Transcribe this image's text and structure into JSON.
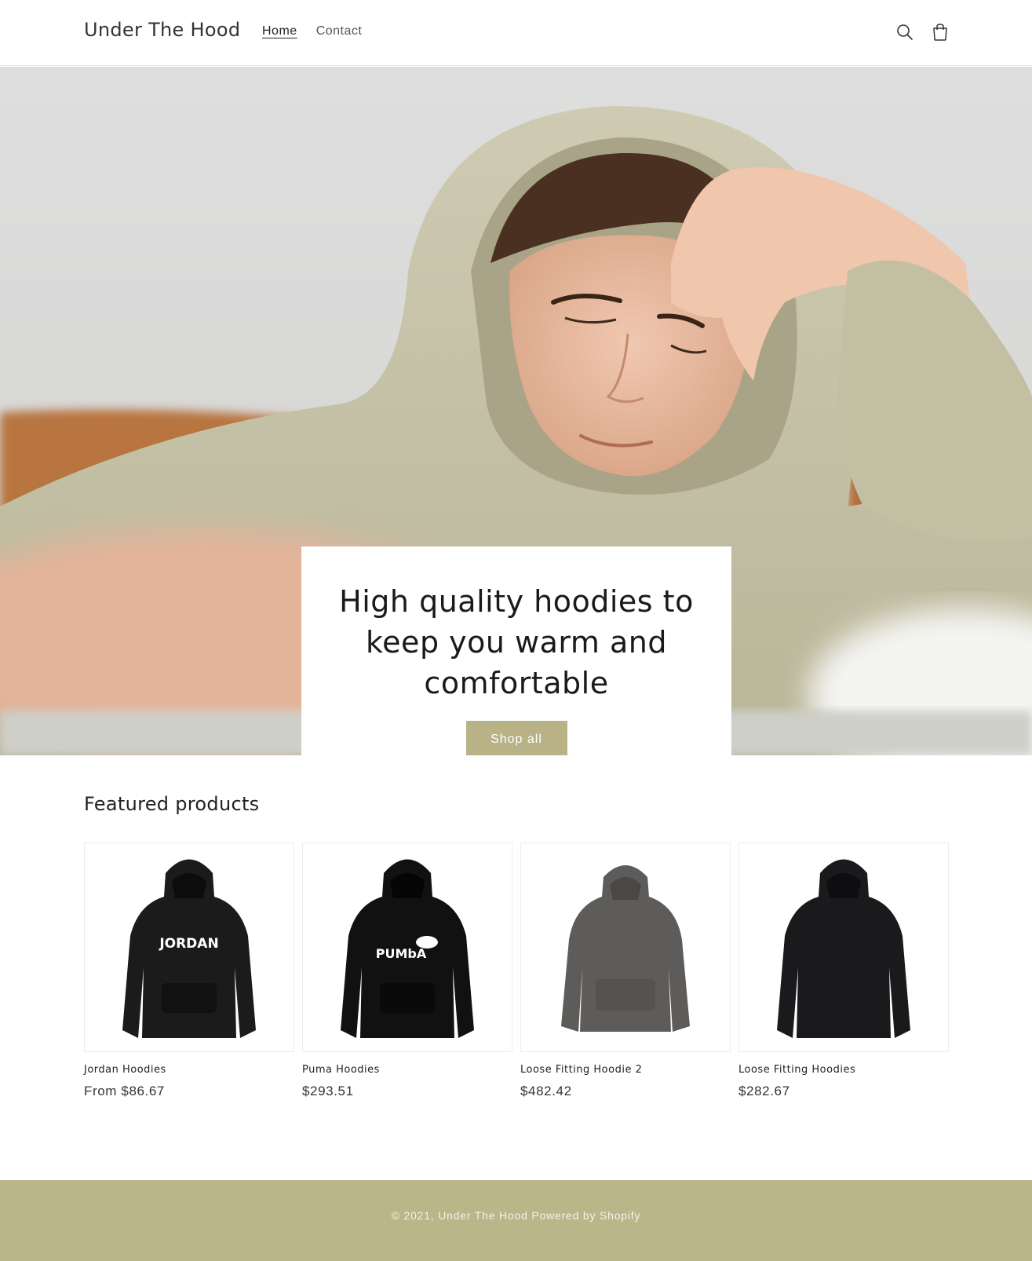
{
  "header": {
    "logo": "Under The Hood",
    "nav": [
      {
        "label": "Home",
        "active": true
      },
      {
        "label": "Contact",
        "active": false
      }
    ],
    "icons": [
      "search-icon",
      "cart-icon"
    ]
  },
  "hero": {
    "heading": "High quality hoodies to keep you warm and comfortable",
    "button_label": "Shop all",
    "button_color": "#b8b286"
  },
  "featured": {
    "title": "Featured products",
    "products": [
      {
        "name": "Jordan Hoodies",
        "price": "From $86.67",
        "color": "#1b1b1b",
        "logo_text": "JORDAN"
      },
      {
        "name": "Puma Hoodies",
        "price": "$293.51",
        "color": "#111111",
        "logo_text": "PUMbA"
      },
      {
        "name": "Loose Fitting Hoodie 2",
        "price": "$482.42",
        "color": "#5e5c5a",
        "logo_text": ""
      },
      {
        "name": "Loose Fitting Hoodies",
        "price": "$282.67",
        "color": "#1a1a1c",
        "logo_text": ""
      }
    ]
  },
  "footer": {
    "copyright": "© 2021, Under The Hood",
    "powered": "Powered by Shopify",
    "background": "#bbb58a"
  }
}
